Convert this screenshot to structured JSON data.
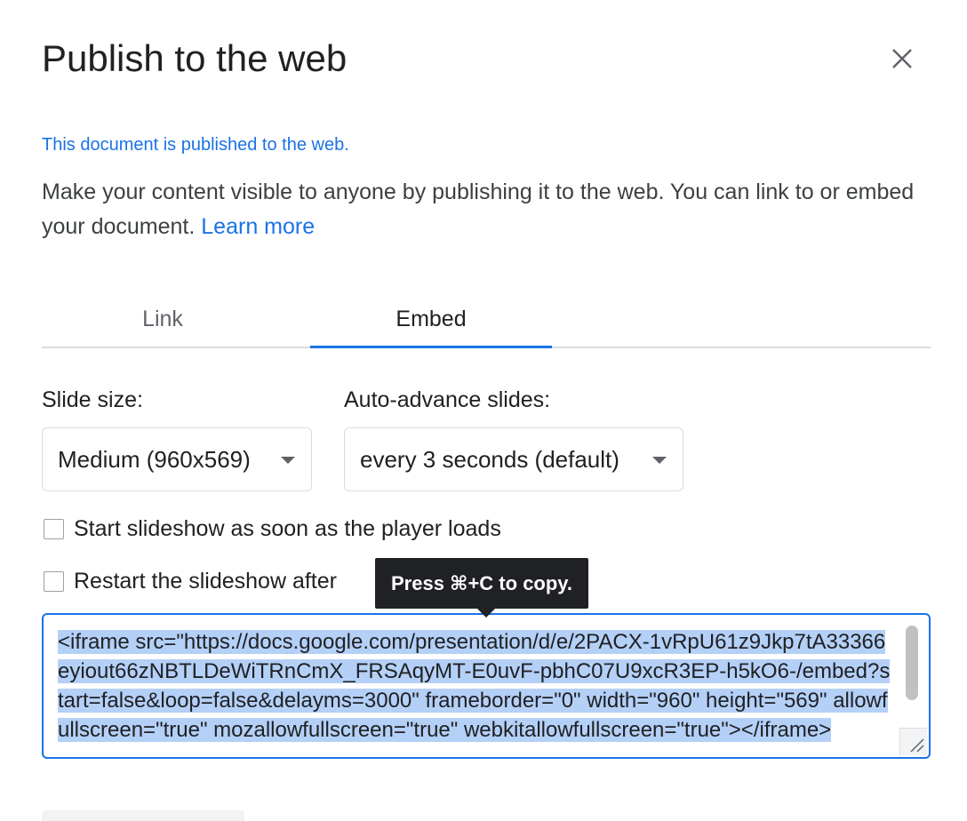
{
  "dialog": {
    "title": "Publish to the web",
    "close_icon": "close-icon"
  },
  "status_text": "This document is published to the web.",
  "description": "Make your content visible to anyone by publishing it to the web. You can link to or embed your document.",
  "learn_more": "Learn more",
  "tabs": [
    {
      "label": "Link",
      "active": false
    },
    {
      "label": "Embed",
      "active": true
    }
  ],
  "slide_size": {
    "label": "Slide size:",
    "value": "Medium (960x569)"
  },
  "auto_advance": {
    "label": "Auto-advance slides:",
    "value": "every 3 seconds (default)"
  },
  "options": [
    {
      "label": "Start slideshow as soon as the player loads",
      "checked": false
    },
    {
      "label": "Restart the slideshow after",
      "checked": false
    }
  ],
  "tooltip": "Press ⌘+C to copy.",
  "embed_code": "<iframe src=\"https://docs.google.com/presentation/d/e/2PACX-1vRpU61z9Jkp7tA33366eyiout66zNBTLDeWiTRnCmX_FRSAqyMT-E0uvF-pbhC07U9xcR3EP-h5kO6-/embed?start=false&loop=false&delayms=3000\" frameborder=\"0\" width=\"960\" height=\"569\" allowfullscreen=\"true\" mozallowfullscreen=\"true\" webkitallowfullscreen=\"true\"></iframe>",
  "colors": {
    "accent": "#1a73e8",
    "selection": "#b4d0f7",
    "tooltip_bg": "#202124"
  }
}
